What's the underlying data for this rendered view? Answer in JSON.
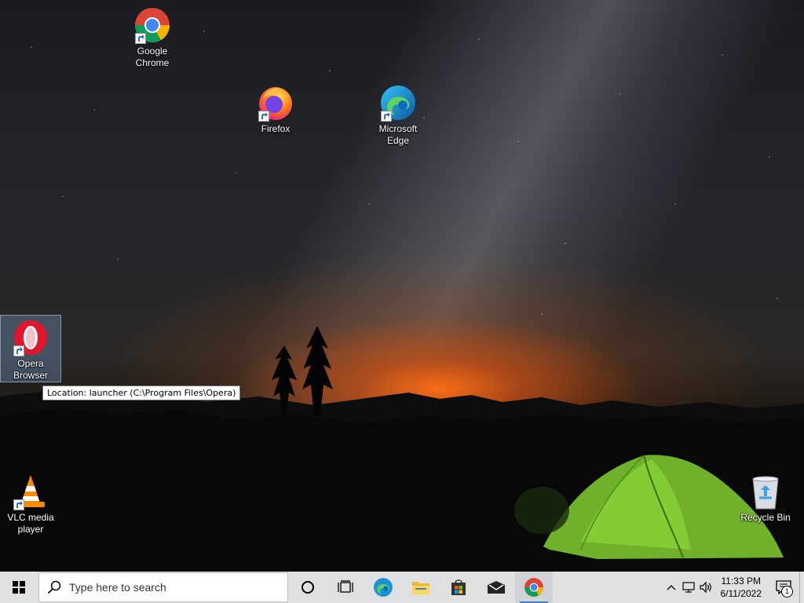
{
  "desktop": {
    "icons": [
      {
        "id": "chrome",
        "label": "Google Chrome",
        "icon": "chrome-icon"
      },
      {
        "id": "firefox",
        "label": "Firefox",
        "icon": "firefox-icon"
      },
      {
        "id": "edge",
        "label": "Microsoft Edge",
        "icon": "edge-icon"
      },
      {
        "id": "opera",
        "label": "Opera Browser",
        "icon": "opera-icon",
        "selected": true
      },
      {
        "id": "vlc",
        "label": "VLC media player",
        "icon": "vlc-icon"
      },
      {
        "id": "recycle",
        "label": "Recycle Bin",
        "icon": "recycle-bin-icon"
      }
    ],
    "tooltip": "Location: launcher (C:\\Program Files\\Opera)"
  },
  "taskbar": {
    "search_placeholder": "Type here to search",
    "pinned": [
      "start-icon",
      "cortana-icon",
      "task-view-icon",
      "edge-icon",
      "file-explorer-icon",
      "store-icon",
      "mail-icon",
      "chrome-icon"
    ],
    "active_app": "chrome",
    "accent_color": "#4c7fbf",
    "clock": {
      "time": "11:33 PM",
      "date": "6/11/2022"
    },
    "notification_count": "1"
  }
}
